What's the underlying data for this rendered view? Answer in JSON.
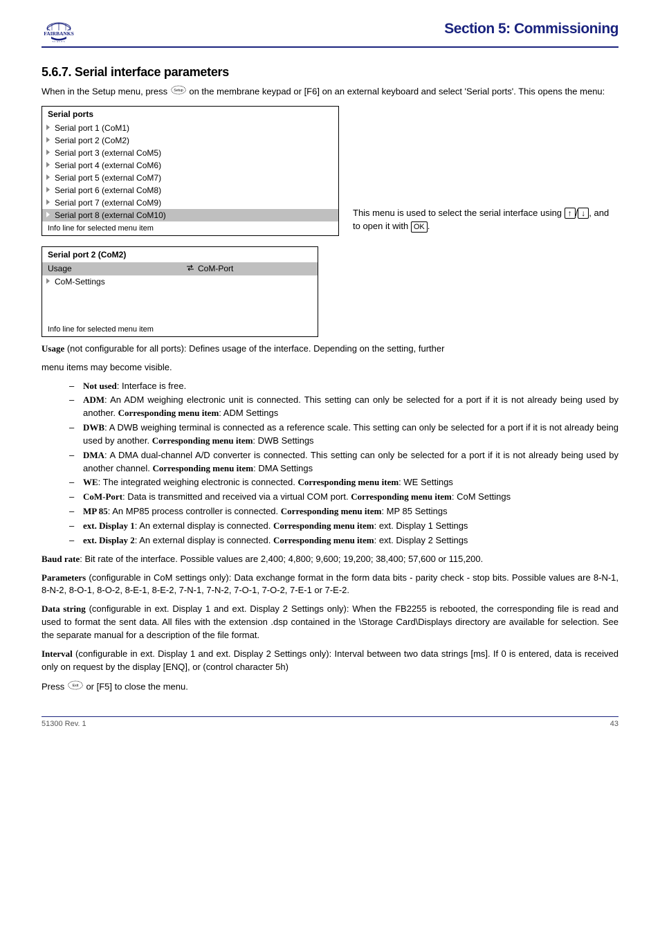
{
  "section_title": "Section 5: Commissioning",
  "heading_num": "5.6.7. Serial interface parameters",
  "intro": "When in the Setup menu, press",
  "intro2": "on the membrane keypad or [F6] on an external keyboard and select 'Serial ports'. This opens the menu:",
  "menu1": {
    "title": "Serial ports",
    "items": [
      "Serial port 1 (CoM1)",
      "Serial port 2 (CoM2)",
      "Serial port 3 (external  CoM5)",
      "Serial port 4 (external  CoM6)",
      "Serial port 5 (external  CoM7)",
      "Serial port 6 (external  CoM8)",
      "Serial port 7 (external  CoM9)"
    ],
    "sel": "Serial port 8 (external  CoM10)",
    "foot": "Info line for selected menu item"
  },
  "side_note_1": "This menu is used to select the serial interface using ",
  "side_note_2": ", and to open it with ",
  "side_note_3": ".",
  "menu2": {
    "title": "Serial port 2 (CoM2)",
    "label": "Usage",
    "val": "CoM-Port",
    "items": [
      "CoM-Settings"
    ],
    "foot": "Info line for selected menu item"
  },
  "para1": {
    "lead": "Usage",
    "text_a": " (not configurable for all ports): Defines usage of the interface. Depending on the setting, further",
    "cont1": "menu items may become visible.",
    "b1_l": "Not used",
    "b1_t": ": Interface is free."
  },
  "bullets": [
    {
      "lead": "ADM",
      "a": ": An ADM weighing electronic unit is connected. This setting can only be selected for a port if it is not already being used by another.",
      "lead2": "Corresponding menu item",
      "a2": ": ADM Settings"
    },
    {
      "lead": "DWB",
      "a": ": A DWB weighing terminal is connected as a reference scale. This setting can only be selected for a port if it is not already being used by another.",
      "lead2": "Corresponding menu item",
      "a2": ": DWB Settings"
    },
    {
      "lead": "DMA",
      "a": ": A DMA dual-channel A/D converter is connected. This setting can only be selected for a port if it is not already being used by another channel.",
      "lead2": "Corresponding menu item",
      "a2": ": DMA Settings"
    },
    {
      "lead": "WE",
      "a": ": The integrated weighing electronic is connected.",
      "lead2": "Corresponding menu item",
      "a2": ": WE Settings"
    },
    {
      "lead": "CoM-Port",
      "a": ": Data is transmitted and received via a virtual COM port.",
      "lead2": "Corresponding menu item",
      "a2": ": CoM Settings"
    },
    {
      "lead": "MP 85",
      "a": ": An MP85 process controller is connected.",
      "lead2": "Corresponding menu item",
      "a2": ": MP 85 Settings"
    },
    {
      "lead": "ext. Display 1",
      "a": ": An external display is connected.",
      "lead2": "Corresponding menu item",
      "a2": ": ext. Display 1 Settings"
    },
    {
      "lead": "ext. Display 2",
      "a": ": An external display is connected.",
      "lead2": "Corresponding menu item",
      "a2": ": ext. Display 2 Settings"
    }
  ],
  "para2": {
    "lead": "Baud rate",
    "text": ": Bit rate of the interface. Possible values are 2,400; 4,800; 9,600; 19,200; 38,400; 57,600 or 115,200."
  },
  "para3": {
    "lead": "Parameters",
    "text": " (configurable in CoM settings only): Data exchange format in the form data bits - parity check - stop bits. Possible values are 8-N-1, 8-N-2, 8-O-1, 8-O-2, 8-E-1, 8-E-2, 7-N-1, 7-N-2, 7-O-1, 7-O-2, 7-E-1 or 7-E-2."
  },
  "para4": {
    "lead": "Data string",
    "text": " (configurable in ext. Display 1 and ext. Display 2 Settings only): When the FB2255 is rebooted, the corresponding file is read and used to format the sent data. All files with the extension .dsp contained in the \\Storage Card\\Displays directory are available for selection. See the separate manual for a description of the file format."
  },
  "para5": {
    "lead": "Interval",
    "text": " (configurable in ext. Display 1 and ext. Display 2 Settings only): Interval between two data strings [ms]. If 0 is entered, data is received only on request by the display [ENQ], or (control character 5h)"
  },
  "exit_para": "Press ",
  "exit_para2": " or [F5] to close the menu.",
  "footer": {
    "left": "51300 Rev. 1",
    "right": "43"
  }
}
